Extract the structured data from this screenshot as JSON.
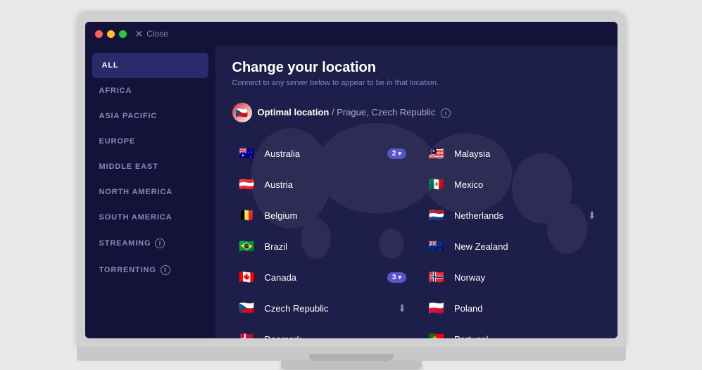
{
  "window": {
    "close_label": "Close",
    "dots": [
      "red",
      "yellow",
      "green"
    ]
  },
  "sidebar": {
    "items": [
      {
        "id": "all",
        "label": "ALL",
        "active": true,
        "info": false
      },
      {
        "id": "africa",
        "label": "AFRICA",
        "active": false,
        "info": false
      },
      {
        "id": "asia-pacific",
        "label": "ASIA PACIFIC",
        "active": false,
        "info": false
      },
      {
        "id": "europe",
        "label": "EUROPE",
        "active": false,
        "info": false
      },
      {
        "id": "middle-east",
        "label": "MIDDLE EAST",
        "active": false,
        "info": false
      },
      {
        "id": "north-america",
        "label": "NORTH AMERICA",
        "active": false,
        "info": false
      },
      {
        "id": "south-america",
        "label": "SOUTH AMERICA",
        "active": false,
        "info": false
      },
      {
        "id": "streaming",
        "label": "STREAMING",
        "active": false,
        "info": true
      },
      {
        "id": "torrenting",
        "label": "TORRENTING",
        "active": false,
        "info": true
      }
    ]
  },
  "main": {
    "title": "Change your location",
    "subtitle": "Connect to any server below to appear to be in that location.",
    "optimal": {
      "label": "Optimal location",
      "location": "Prague, Czech Republic",
      "flag": "🇨🇿"
    },
    "countries_left": [
      {
        "name": "Australia",
        "flag": "🇦🇺",
        "servers": 2,
        "has_chevron": true,
        "has_download": false
      },
      {
        "name": "Austria",
        "flag": "🇦🇹",
        "servers": 0,
        "has_chevron": false,
        "has_download": false
      },
      {
        "name": "Belgium",
        "flag": "🇧🇪",
        "servers": 0,
        "has_chevron": false,
        "has_download": false
      },
      {
        "name": "Brazil",
        "flag": "🇧🇷",
        "servers": 0,
        "has_chevron": false,
        "has_download": false
      },
      {
        "name": "Canada",
        "flag": "🇨🇦",
        "servers": 3,
        "has_chevron": true,
        "has_download": false
      },
      {
        "name": "Czech Republic",
        "flag": "🇨🇿",
        "servers": 0,
        "has_chevron": false,
        "has_download": true
      },
      {
        "name": "Denmark",
        "flag": "🇩🇰",
        "servers": 0,
        "has_chevron": false,
        "has_download": false
      }
    ],
    "countries_right": [
      {
        "name": "Malaysia",
        "flag": "🇲🇾",
        "servers": 0,
        "has_chevron": false,
        "has_download": false
      },
      {
        "name": "Mexico",
        "flag": "🇲🇽",
        "servers": 0,
        "has_chevron": false,
        "has_download": false
      },
      {
        "name": "Netherlands",
        "flag": "🇳🇱",
        "servers": 0,
        "has_chevron": false,
        "has_download": true
      },
      {
        "name": "New Zealand",
        "flag": "🇳🇿",
        "servers": 0,
        "has_chevron": false,
        "has_download": false
      },
      {
        "name": "Norway",
        "flag": "🇳🇴",
        "servers": 0,
        "has_chevron": false,
        "has_download": false
      },
      {
        "name": "Poland",
        "flag": "🇵🇱",
        "servers": 0,
        "has_chevron": false,
        "has_download": false
      },
      {
        "name": "Portugal",
        "flag": "🇵🇹",
        "servers": 0,
        "has_chevron": false,
        "has_download": false
      }
    ]
  },
  "colors": {
    "accent": "#5555cc",
    "bg_dark": "#13133a",
    "bg_mid": "#1e1e4a",
    "text_primary": "#ffffff",
    "text_muted": "#8888bb"
  }
}
